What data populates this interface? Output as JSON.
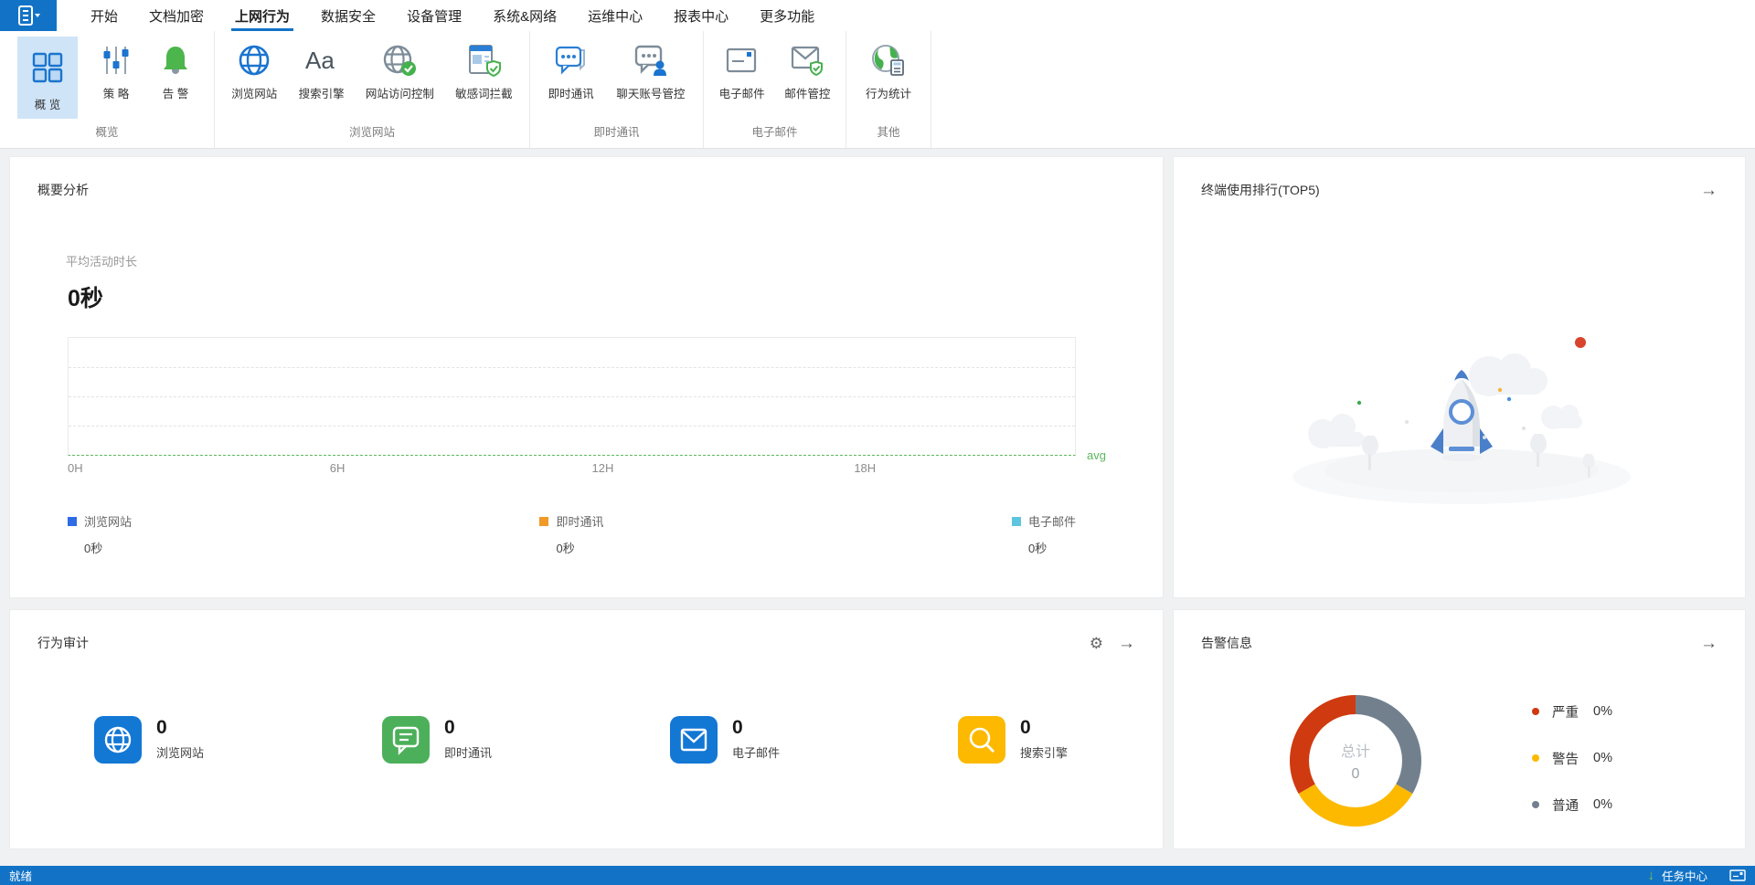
{
  "menu": {
    "items": [
      {
        "label": "开始"
      },
      {
        "label": "文档加密"
      },
      {
        "label": "上网行为",
        "active": "true"
      },
      {
        "label": "数据安全"
      },
      {
        "label": "设备管理"
      },
      {
        "label": "系统&网络"
      },
      {
        "label": "运维中心"
      },
      {
        "label": "报表中心"
      },
      {
        "label": "更多功能"
      }
    ]
  },
  "ribbon": {
    "groups": [
      {
        "label": "概览",
        "buttons": [
          {
            "label": "概 览",
            "icon": "overview-grid-icon",
            "selected": "true"
          },
          {
            "label": "策 略",
            "icon": "policy-sliders-icon"
          },
          {
            "label": "告 警",
            "icon": "alarm-bell-icon"
          }
        ]
      },
      {
        "label": "浏览网站",
        "buttons": [
          {
            "label": "浏览网站",
            "icon": "browse-globe-icon"
          },
          {
            "label": "搜索引擎",
            "icon": "search-aa-icon"
          },
          {
            "label": "网站访问控制",
            "icon": "site-access-control-icon"
          },
          {
            "label": "敏感词拦截",
            "icon": "sensitive-word-block-icon"
          }
        ]
      },
      {
        "label": "即时通讯",
        "buttons": [
          {
            "label": "即时通讯",
            "icon": "instant-message-icon"
          },
          {
            "label": "聊天账号管控",
            "icon": "chat-account-control-icon"
          }
        ]
      },
      {
        "label": "电子邮件",
        "buttons": [
          {
            "label": "电子邮件",
            "icon": "email-icon"
          },
          {
            "label": "邮件管控",
            "icon": "mail-control-icon"
          }
        ]
      },
      {
        "label": "其他",
        "buttons": [
          {
            "label": "行为统计",
            "icon": "behavior-stats-icon"
          }
        ]
      }
    ]
  },
  "panels": {
    "summary": {
      "title": "概要分析",
      "metric_label": "平均活动时长",
      "metric_value": "0秒",
      "avg_label": "avg",
      "avg_color": "#5cb85c",
      "x_ticks": [
        "0H",
        "6H",
        "12H",
        "18H"
      ],
      "legend": [
        {
          "label": "浏览网站",
          "value": "0秒",
          "color": "#2e6be5"
        },
        {
          "label": "即时通讯",
          "value": "0秒",
          "color": "#f09a28"
        },
        {
          "label": "电子邮件",
          "value": "0秒",
          "color": "#5ec5de"
        }
      ]
    },
    "top5": {
      "title": "终端使用排行(TOP5)"
    },
    "audit": {
      "title": "行为审计",
      "stats": [
        {
          "label": "浏览网站",
          "value": "0",
          "color": "#1377d4",
          "icon": "globe-stat-icon"
        },
        {
          "label": "即时通讯",
          "value": "0",
          "color": "#4cb05a",
          "icon": "chat-stat-icon"
        },
        {
          "label": "电子邮件",
          "value": "0",
          "color": "#1377d4",
          "icon": "mail-stat-icon"
        },
        {
          "label": "搜索引擎",
          "value": "0",
          "color": "#fcb900",
          "icon": "search-stat-icon"
        }
      ]
    },
    "alerts": {
      "title": "告警信息",
      "donut": {
        "center_label": "总计",
        "center_value": "0",
        "segments": [
          {
            "label": "严重",
            "pct": "0%",
            "color": "#cf3a10"
          },
          {
            "label": "警告",
            "pct": "0%",
            "color": "#fcb900"
          },
          {
            "label": "普通",
            "pct": "0%",
            "color": "#72808e"
          }
        ]
      }
    }
  },
  "statusbar": {
    "ready": "就绪",
    "task_center": "任务中心"
  },
  "icons": {
    "arrow_right": "→",
    "gear": "⚙",
    "task_download_arrow": "↓"
  },
  "chart_data": [
    {
      "type": "area",
      "title": "概要分析 - 平均活动时长",
      "x_ticks": [
        "0H",
        "6H",
        "12H",
        "18H"
      ],
      "x_range_hours": [
        0,
        23
      ],
      "series": [
        {
          "name": "浏览网站",
          "value_label": "0秒",
          "values": [],
          "color": "#2e6be5"
        },
        {
          "name": "即时通讯",
          "value_label": "0秒",
          "values": [],
          "color": "#f09a28"
        },
        {
          "name": "电子邮件",
          "value_label": "0秒",
          "values": [],
          "color": "#5ec5de"
        }
      ],
      "avg_line": {
        "label": "avg",
        "value": 0,
        "color": "#5cb85c",
        "style": "dashed"
      },
      "grid": "horizontal-dashed",
      "note": "no data plotted (all zero)"
    },
    {
      "type": "pie",
      "title": "告警信息",
      "center_label": "总计",
      "center_value": 0,
      "slices": [
        {
          "label": "普通",
          "pct_label": "0%",
          "display_fraction": 0.333,
          "color": "#72808e"
        },
        {
          "label": "警告",
          "pct_label": "0%",
          "display_fraction": 0.333,
          "color": "#fcb900"
        },
        {
          "label": "严重",
          "pct_label": "0%",
          "display_fraction": 0.334,
          "color": "#cf3a10"
        }
      ],
      "legend_position": "right",
      "donut": true
    }
  ]
}
